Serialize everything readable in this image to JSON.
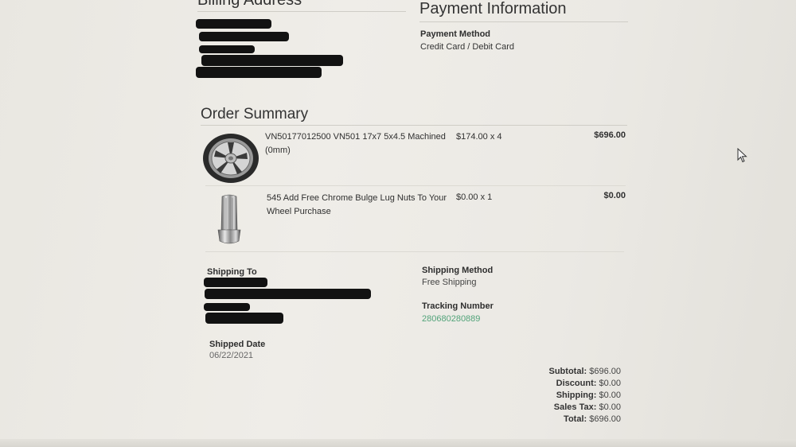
{
  "billing": {
    "title": "Billing Address"
  },
  "payment": {
    "title": "Payment Information",
    "method_label": "Payment Method",
    "method_value": "Credit Card / Debit Card"
  },
  "order_summary": {
    "title": "Order Summary",
    "items": [
      {
        "description": "VN50177012500 VN501 17x7 5x4.5 Machined (0mm)",
        "unit_price_qty": "$174.00 x 4",
        "total": "$696.00",
        "image": "wheel-image"
      },
      {
        "description": "545 Add Free Chrome Bulge Lug Nuts To Your Wheel Purchase",
        "unit_price_qty": "$0.00 x 1",
        "total": "$0.00",
        "image": "lug-nut-image"
      }
    ]
  },
  "shipping": {
    "to_label": "Shipping To",
    "method_label": "Shipping Method",
    "method_value": "Free Shipping",
    "tracking_label": "Tracking Number",
    "tracking_value": "280680280889",
    "shipped_date_label": "Shipped Date",
    "shipped_date_value": "06/22/2021"
  },
  "totals": {
    "subtotal_label": "Subtotal:",
    "subtotal_value": "$696.00",
    "discount_label": "Discount:",
    "discount_value": "$0.00",
    "shipping_label": "Shipping:",
    "shipping_value": "$0.00",
    "tax_label": "Sales Tax:",
    "tax_value": "$0.00",
    "total_label": "Total:",
    "total_value": "$696.00"
  },
  "colors": {
    "link": "#52a37a",
    "redaction": "#121212"
  }
}
